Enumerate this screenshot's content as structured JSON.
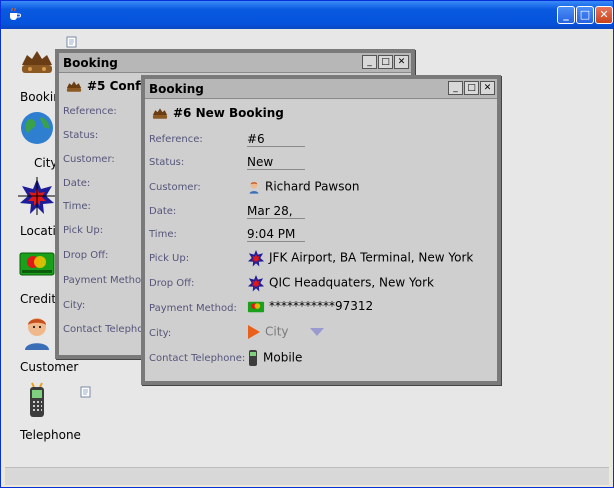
{
  "desktop_icons": [
    {
      "icon": "booking-icon",
      "label": "Booking"
    },
    {
      "icon": "city-icon",
      "label": "City"
    },
    {
      "icon": "location-icon",
      "label": "Location"
    },
    {
      "icon": "credit-card-icon",
      "label": "Credit Card"
    },
    {
      "icon": "customer-icon",
      "label": "Customer"
    },
    {
      "icon": "telephone-icon",
      "label": "Telephone"
    }
  ],
  "back_window": {
    "title": "Booking",
    "heading": "#5 Confirmed Booking",
    "fields": [
      "Reference:",
      "Status:",
      "Customer:",
      "Date:",
      "Time:",
      "Pick Up:",
      "Drop Off:",
      "Payment Method:",
      "City:",
      "Contact Telephone:"
    ]
  },
  "front_window": {
    "title": "Booking",
    "heading": "#6 New Booking",
    "fields": [
      {
        "label": "Reference:",
        "value": "#6"
      },
      {
        "label": "Status:",
        "value": "New"
      },
      {
        "label": "Customer:",
        "value": "Richard Pawson",
        "icon": "customer-icon"
      },
      {
        "label": "Date:",
        "value": "Mar 28,"
      },
      {
        "label": "Time:",
        "value": "9:04 PM"
      },
      {
        "label": "Pick Up:",
        "value": "JFK Airport, BA Terminal, New York",
        "icon": "location-icon"
      },
      {
        "label": "Drop Off:",
        "value": "QIC Headquaters, New York",
        "icon": "location-icon"
      },
      {
        "label": "Payment Method:",
        "value": "***********97312",
        "icon": "credit-card-icon"
      },
      {
        "label": "City:",
        "value": "City",
        "icon": "city-flag-icon"
      },
      {
        "label": "Contact Telephone:",
        "value": "Mobile",
        "icon": "telephone-icon"
      }
    ]
  },
  "window_controls": {
    "minimize": "_",
    "maximize": "□",
    "close": "✕"
  }
}
